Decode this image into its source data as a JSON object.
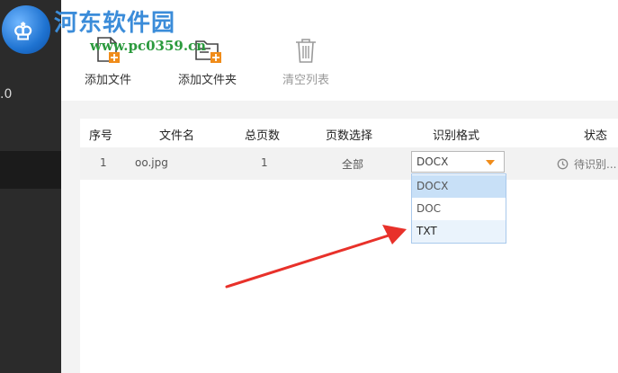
{
  "sidebar": {
    "version": ".0"
  },
  "watermark": {
    "site_name": "河东软件园",
    "site_url": "www.pc0359.cn"
  },
  "toolbar": {
    "add_file": "添加文件",
    "add_folder": "添加文件夹",
    "clear_list": "清空列表"
  },
  "table": {
    "headers": [
      "序号",
      "文件名",
      "总页数",
      "页数选择",
      "识别格式",
      "状态"
    ],
    "rows": [
      {
        "index": "1",
        "filename": "oo.jpg",
        "total_pages": "1",
        "page_select": "全部",
        "format": "DOCX",
        "status": "待识别..."
      }
    ]
  },
  "format_dropdown": {
    "options": [
      "DOCX",
      "DOC",
      "TXT"
    ],
    "selected": "DOCX",
    "hovered": "TXT"
  },
  "colors": {
    "accent": "#f08c1a",
    "arrow": "#e8312a",
    "selected": "#c8e0f7"
  }
}
